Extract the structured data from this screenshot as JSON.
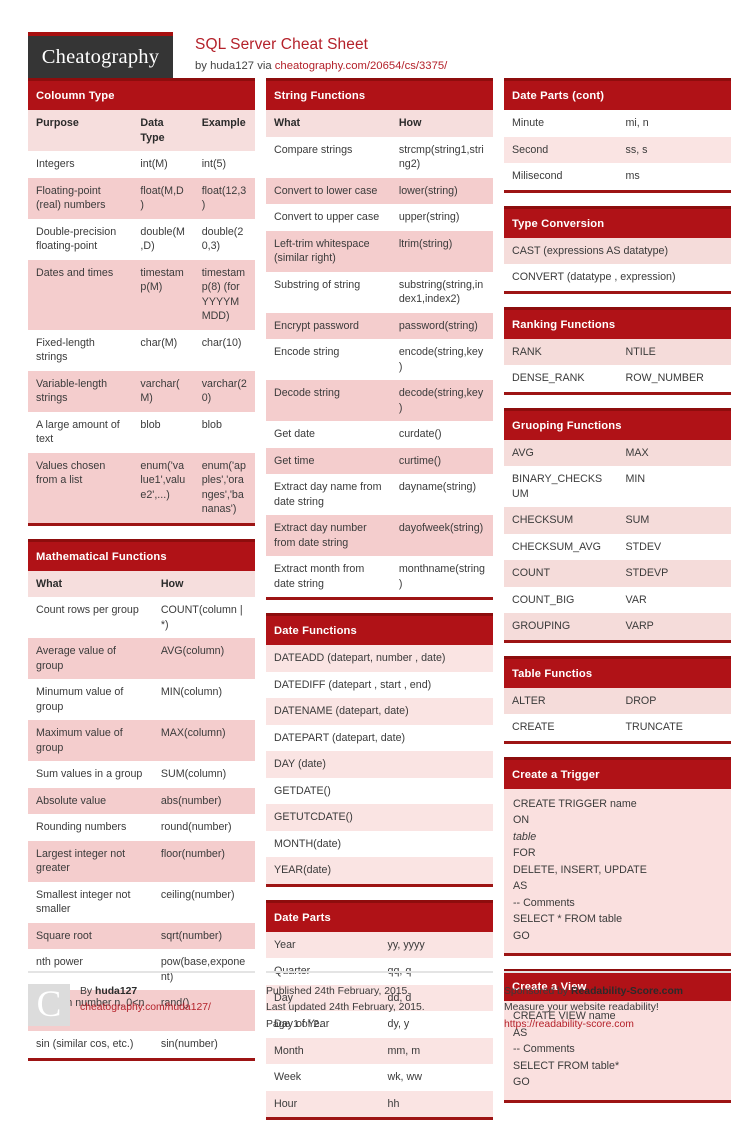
{
  "header": {
    "logo": "Cheatography",
    "title": "SQL Server Cheat Sheet",
    "byline_prefix": "by huda127 via ",
    "byline_link": "cheatography.com/20654/cs/3375/"
  },
  "colors": {
    "brand_red": "#b01217",
    "head_top": "#8d0d0d",
    "accent_link": "#b4212a",
    "logo_bg": "#353535",
    "row_shade": "#f4cdcd"
  },
  "cards": {
    "coloumn_type": {
      "title": "Coloumn Type",
      "headers": [
        "Purpose",
        "Data Type",
        "Example"
      ],
      "rows": [
        [
          "Integers",
          "int(M)",
          "int(5)"
        ],
        [
          "Floating-point (real) numbers",
          "float(M,D)",
          "float(12,3)"
        ],
        [
          "Double-precision floating-point",
          "double(M,D)",
          "double(20,3)"
        ],
        [
          "Dates and times",
          "timestamp(M)",
          "timestamp(8) (for YYYYMMDD)"
        ],
        [
          "Fixed-length strings",
          "char(M)",
          "char(10)"
        ],
        [
          "Variable-length strings",
          "varchar(M)",
          "varchar(20)"
        ],
        [
          "A large amount of text",
          "blob",
          "blob"
        ],
        [
          "Values chosen from a list",
          "enum('value1',value2',...)",
          "enum('apples','oranges','bananas')"
        ]
      ]
    },
    "mathematical_functions": {
      "title": "Mathematical Functions",
      "headers": [
        "What",
        "How"
      ],
      "rows": [
        [
          "Count rows per group",
          "COUNT(column | *)"
        ],
        [
          "Average value of group",
          "AVG(column)"
        ],
        [
          "Minumum value of group",
          "MIN(column)"
        ],
        [
          "Maximum value of group",
          "MAX(column)"
        ],
        [
          "Sum values in a group",
          "SUM(column)"
        ],
        [
          "Absolute value",
          "abs(number)"
        ],
        [
          "Rounding numbers",
          "round(number)"
        ],
        [
          "Largest integer not greater",
          "floor(number)"
        ],
        [
          "Smallest integer not smaller",
          "ceiling(number)"
        ],
        [
          "Square root",
          "sqrt(number)"
        ],
        [
          "nth power",
          "pow(base,exponent)"
        ],
        [
          "random number n, 0<n < 1",
          "rand()"
        ],
        [
          "sin (similar cos, etc.)",
          "sin(number)"
        ]
      ]
    },
    "string_functions": {
      "title": "String Functions",
      "headers": [
        "What",
        "How"
      ],
      "rows": [
        [
          "Compare strings",
          "strcmp(string1,string2)"
        ],
        [
          "Convert to lower case",
          "lower(string)"
        ],
        [
          "Convert to upper case",
          "upper(string)"
        ],
        [
          "Left-trim whitespace (similar right)",
          "ltrim(string)"
        ],
        [
          "Substring of string",
          "substring(string,index1,index2)"
        ],
        [
          "Encrypt password",
          "password(string)"
        ],
        [
          "Encode string",
          "encode(string,key)"
        ],
        [
          "Decode string",
          "decode(string,key)"
        ],
        [
          "Get date",
          "curdate()"
        ],
        [
          "Get time",
          "curtime()"
        ],
        [
          "Extract day name from date string",
          "dayname(string)"
        ],
        [
          "Extract day number from date string",
          "dayofweek(string)"
        ],
        [
          "Extract month from date string",
          "monthname(string)"
        ]
      ]
    },
    "date_functions": {
      "title": "Date Functions",
      "rows": [
        "DATEADD (datepart, number , date)",
        "DATEDIFF (datepart , start , end)",
        "DATENAME (datepart, date)",
        "DATEPART (datepart, date)",
        "DAY (date)",
        "GETDATE()",
        "GETUTCDATE()",
        "MONTH(date)",
        "YEAR(date)"
      ]
    },
    "date_parts": {
      "title": "Date Parts",
      "rows": [
        [
          "Year",
          "yy, yyyy"
        ],
        [
          "Quarter",
          "qq, q"
        ],
        [
          "Day",
          "dd, d"
        ],
        [
          "Day of Year",
          "dy, y"
        ],
        [
          "Month",
          "mm, m"
        ],
        [
          "Week",
          "wk, ww"
        ],
        [
          "Hour",
          "hh"
        ]
      ]
    },
    "date_parts_cont": {
      "title": "Date Parts (cont)",
      "rows": [
        [
          "Minute",
          "mi, n"
        ],
        [
          "Second",
          "ss, s"
        ],
        [
          "Milisecond",
          "ms"
        ]
      ]
    },
    "type_conversion": {
      "title": "Type Conversion",
      "rows": [
        "CAST (expressions AS datatype)",
        "CONVERT (datatype , expression)"
      ]
    },
    "ranking_functions": {
      "title": "Ranking Functions",
      "rows": [
        [
          "RANK",
          "NTILE"
        ],
        [
          "DENSE_RANK",
          "ROW_NUMBER"
        ]
      ]
    },
    "grouping_functions": {
      "title": "Gruoping Functions",
      "rows": [
        [
          "AVG",
          "MAX"
        ],
        [
          "BINARY_CHECKSUM",
          "MIN"
        ],
        [
          "CHECKSUM",
          "SUM"
        ],
        [
          "CHECKSUM_AVG",
          "STDEV"
        ],
        [
          "COUNT",
          "STDEVP"
        ],
        [
          "COUNT_BIG",
          "VAR"
        ],
        [
          "GROUPING",
          "VARP"
        ]
      ]
    },
    "table_functios": {
      "title": "Table Functios",
      "rows": [
        [
          "ALTER",
          "DROP"
        ],
        [
          "CREATE",
          "TRUNCATE"
        ]
      ]
    },
    "create_a_trigger": {
      "title": "Create a Trigger",
      "lines": [
        "CREATE TRIGGER name",
        "ON",
        "table",
        "FOR",
        "DELETE, INSERT, UPDATE",
        "AS",
        "-- Comments",
        "SELECT * FROM table",
        "GO"
      ]
    },
    "create_a_view": {
      "title": "Create a View",
      "lines": [
        "CREATE VIEW name",
        "AS",
        "-- Comments",
        "SELECT FROM table*",
        "GO"
      ]
    }
  },
  "footer": {
    "badge": "C",
    "author_prefix": "By ",
    "author": "huda127",
    "author_link": "cheatography.com/huda127/",
    "published": "Published 24th February, 2015.",
    "updated": "Last updated 24th February, 2015.",
    "page": "Page 1 of 2.",
    "sponsor_prefix": "Sponsored by ",
    "sponsor": "Readability-Score.com",
    "sponsor_tagline": "Measure your website readability!",
    "sponsor_link": "https://readability-score.com"
  }
}
